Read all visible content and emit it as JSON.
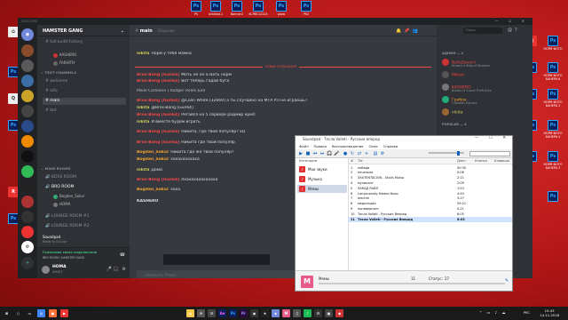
{
  "desktop": {
    "top_icons": [
      "PS",
      "Untitled-1",
      "Banner2",
      "KCP6C12225",
      "plaro",
      "PS2"
    ],
    "right_icons": [
      "PS",
      "НОРМ ФОТО",
      "ПОЛНЫЙ РАЗРЕЗ",
      "PS",
      "НОРМ ФОТО БАНЕРА 6",
      "PS",
      "НОРМ ФОТО БАНЕРА 5",
      "PS",
      "НОРМ ФОТО БАНЕРА 4",
      "PS",
      "НОРМ ФОТО БАНЕРА 3",
      "PS"
    ],
    "left_icons": [
      "КОРЗИНА",
      "PS",
      "QIP 2012",
      "PS",
      "Rockstar",
      "PS"
    ]
  },
  "discord": {
    "app_title": "DISCORD",
    "server_name": "HAMSTER GANG",
    "channels": {
      "full_audit": "full-audit-history",
      "text_cat": "TEXT CHANNELS",
      "welcome": "welcome",
      "info": "info",
      "main": "main",
      "bot": "bot",
      "voice_cat": "MAIN ROOMS",
      "boss": "BOSS ROOM",
      "bro": "BRO ROOM",
      "lounge1": "LOUNGE ROOM #1",
      "lounge2": "LOUNGE ROOM #2",
      "top_users": [
        "KASHERO",
        "FARHITH"
      ],
      "bro_users": [
        "Bogdan_Sokur",
        "HOMA"
      ]
    },
    "voice_status": {
      "title": "Голосовая связь подключена",
      "channel": "BRO ROOM / HAMSTER GANG",
      "soundpad_label": "Soundpad",
      "soundpad_sub": "Ready to Go Live"
    },
    "user": {
      "name": "HOMA",
      "tag": "#9347"
    },
    "chat": {
      "channel": "main",
      "topic": "Общение",
      "search_placeholder": "Поиск",
      "new_messages_label": "НОВЫЕ СООБЩЕНИЯ",
      "input_placeholder": "Написать #main"
    },
    "messages": [
      {
        "name": "nikita",
        "time": "",
        "text": "Норм у тебя мамка",
        "color": "#c9cc57"
      },
      {
        "name": "Bros-Bang [Gun64]",
        "time": "",
        "text": "Мать не он а мать норм",
        "color": "#f04747"
      },
      {
        "name": "Bros-Bang [Gun64]",
        "time": "",
        "text": "Вот теперь гадай буга",
        "color": "#f04747"
      },
      {
        "name": "",
        "time": "",
        "text": "Mikol Corleone | Rodger Roles Бля",
        "color": "#dcddde"
      },
      {
        "name": "Bros-Bang [Gun64]",
        "time": "",
        "text": "@Colin White [32069] а ты случайно на МТА РП не играешь?",
        "color": "#f04747"
      },
      {
        "name": "nikita",
        "time": "",
        "text": "@Bros-Bang [Gun64]",
        "color": "#c9cc57"
      },
      {
        "name": "Bros-Bang [Gun64]",
        "time": "",
        "text": "Регайся на 5 сервере радмир крмп",
        "color": "#f04747"
      },
      {
        "name": "nikita",
        "time": "",
        "text": "И вместе будем играть",
        "color": "#c9cc57"
      },
      {
        "name": "Bros-Bang [Gun64]",
        "time": "",
        "text": "Никита, где твой популяр? xD",
        "color": "#f04747"
      },
      {
        "name": "Bros-Bang [Gun64]",
        "time": "",
        "text": "Никита где твой популяр",
        "color": "#f04747"
      },
      {
        "name": "Bogdan_Sokur",
        "time": "",
        "text": "Никита где же твой популяр?",
        "color": "#f0a030"
      },
      {
        "name": "Bogdan_Sokur",
        "time": "",
        "text": "хахахахахаха",
        "color": "#f0a030"
      },
      {
        "name": "nikita",
        "time": "",
        "text": "Дома",
        "color": "#c9cc57"
      },
      {
        "name": "Bros-Bang [Gun64]",
        "time": "",
        "text": "Ахахахахахахаха",
        "color": "#f04747"
      },
      {
        "name": "Bogdan_Sokur",
        "time": "",
        "text": "хаха",
        "color": "#f0a030"
      },
      {
        "name": "KASHERO",
        "time": "",
        "text": "",
        "color": "#dcddde"
      }
    ],
    "members": {
      "admin_cat": "АДМИН — 4",
      "popular_cat": "POPULAR — 4",
      "list": [
        {
          "name": "BullsZaverri",
          "activity": "Играет в Blog of Blyadam",
          "color": "#f04747",
          "av": "#c33"
        },
        {
          "name": "Mithor",
          "activity": "",
          "color": "#f04747",
          "av": "#555"
        },
        {
          "name": "KASHERO",
          "activity": "Играет в Grand Theft Auto",
          "color": "#f04747",
          "av": "#777"
        },
        {
          "name": "Грибок",
          "activity": "Стримит Discord",
          "color": "#f0a030",
          "av": "#2a7"
        },
        {
          "name": "nikita",
          "activity": "",
          "color": "#c9cc57",
          "av": "#963"
        }
      ]
    }
  },
  "soundpad": {
    "title": "Soundpad - Тесла Volleti - Русские вперед",
    "menu": [
      "Файл",
      "Правка",
      "Воспроизведение",
      "Окно",
      "Справка"
    ],
    "categories_header": "Категории",
    "categories": [
      "Мои звуки",
      "Музыка",
      "Мемы"
    ],
    "columns": [
      "#",
      "Тег",
      "Длит.",
      "Кнопка",
      "Клавиша"
    ],
    "rows": [
      {
        "n": "1",
        "tag": "победа",
        "dur": "00:30"
      },
      {
        "n": "2",
        "tag": "печалька",
        "dur": "0:06"
      },
      {
        "n": "3",
        "tag": "XXXTENTACION - Skulls Mulsa",
        "dur": "2:11"
      },
      {
        "n": "4",
        "tag": "музыкант",
        "dur": "2:09"
      },
      {
        "n": "5",
        "tag": "ЗАКАД РАЙЛ",
        "dur": "1:53"
      },
      {
        "n": "6",
        "tag": "Lanyonovsky Камни Коко",
        "dur": "4:40"
      },
      {
        "n": "7",
        "tag": "electrik",
        "dur": "3:27"
      },
      {
        "n": "8",
        "tag": "медитация",
        "dur": "59:21"
      },
      {
        "n": "9",
        "tag": "ноневерналт",
        "dur": "0:21"
      },
      {
        "n": "10",
        "tag": "Тесла Volleti - Русские Вперед",
        "dur": "6:05"
      },
      {
        "n": "11",
        "tag": "Тесла Volleti - Русские Вперед",
        "dur": "6:03"
      }
    ],
    "status": {
      "category": "Мемы",
      "count": "11",
      "total_label": "Статус:",
      "total": "27"
    }
  },
  "taskbar": {
    "time": "15:43",
    "date": "14.11.2018",
    "lang": "РУС"
  }
}
